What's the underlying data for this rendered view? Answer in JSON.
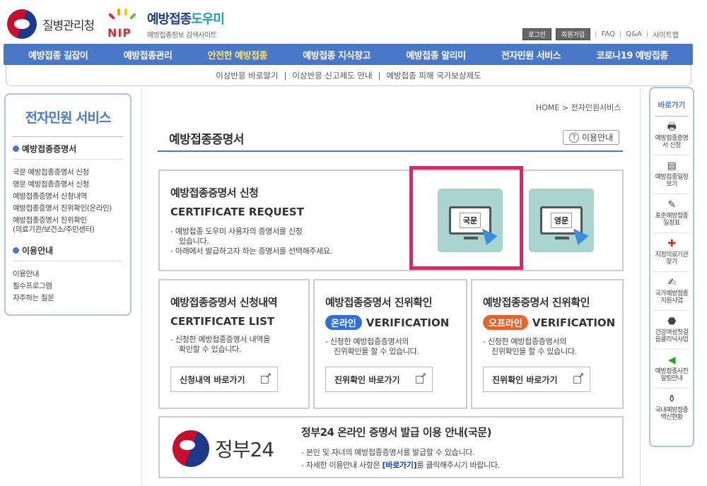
{
  "header": {
    "kdca_name": "질병관리청",
    "nip_letters": "NIP",
    "site_title_part1": "예방접종",
    "site_title_part2": "도우미",
    "site_subtitle": "예방접종정보 검색사이트",
    "util": {
      "login": "로그인",
      "join": "회원가입",
      "faq": "FAQ",
      "qna": "Q&A",
      "sitemap": "사이트맵",
      "sep": "|"
    }
  },
  "gnb": [
    {
      "label": "예방접종 길잡이",
      "active": false
    },
    {
      "label": "예방접종관리",
      "active": false
    },
    {
      "label": "안전한 예방접종",
      "active": true
    },
    {
      "label": "예방접종 지식창고",
      "active": false
    },
    {
      "label": "예방접종 알리미",
      "active": false
    },
    {
      "label": "전자민원 서비스",
      "active": false
    },
    {
      "label": "코로나19 예방접종",
      "active": false
    }
  ],
  "sub_gnb": [
    "이상반응 바로알기",
    "|",
    "이상반응 신고제도 안내",
    "|",
    "예방접종 피해 국가보상제도"
  ],
  "lnb": {
    "title": "전자민원 서비스",
    "section1": "예방접종증명서",
    "section1_items": [
      "국문 예방접종증명서 신청",
      "영문 예방접종증명서 신청",
      "예방접종증명서 신청내역",
      "예방접종증명서 진위확인(온라인)",
      "예방접종증명서 진위확인",
      "(의료기관/보건소/주민센터)"
    ],
    "section2": "이용안내",
    "section2_items": [
      "이용안내",
      "필수프로그램",
      "자주하는 질문"
    ]
  },
  "main": {
    "breadcrumb": "HOME > 전자민원서비스",
    "page_title": "예방접종증명서",
    "guide_button": "이용안내",
    "guide_icon": "?",
    "request": {
      "title": "예방접종증명서 신청",
      "en": "CERTIFICATE REQUEST",
      "desc1": "- 예방접종 도우미 사용자의 증명서를 신청",
      "desc2": "있습니다.",
      "desc3": "- 아래에서 발급하고자 하는 증명서를 선택해주세요.",
      "korean_card": "국문",
      "english_card": "영문"
    },
    "list": {
      "title": "예방접종증명서 신청내역",
      "en": "CERTIFICATE LIST",
      "desc1": "- 신청한 예방접종증명서 내역을",
      "desc2": "확인할 수 있습니다.",
      "button": "신청내역 바로가기"
    },
    "verify_online": {
      "title": "예방접종증명서 진위확인",
      "badge": "온라인",
      "badge_color": "#2f6fd6",
      "en": "VERIFICATION",
      "desc1": "- 신청한 예방접종증명서의",
      "desc2": "진위확인을 할 수 있습니다.",
      "button": "진위확인 바로가기"
    },
    "verify_offline": {
      "title": "예방접종증명서 진위확인",
      "badge": "오프라인",
      "badge_color": "#e8632b",
      "en": "VERIFICATION",
      "desc1": "- 신청한 예방접종증명서의",
      "desc2": "진위확인을 할 수 있습니다.",
      "button": "진위확인 바로가기"
    },
    "gov24": {
      "logo_text": "정부24",
      "title": "정부24 온라인 증명서 발급 이용 안내(국문)",
      "desc1": "- 본인 및 자녀의 예방접종증명서를 발급할 수 있습니다.",
      "desc2_prefix": "- 자세한 이용안내 사항은 ",
      "desc2_link": "[바로가기]",
      "desc2_suffix": "를 클릭해주시기 바랍니다."
    }
  },
  "quick": {
    "title": "바로가기",
    "items": [
      {
        "icon": "printer-icon",
        "label": "예방접종증명서 신청"
      },
      {
        "icon": "calendar-icon",
        "label": "예방접종일정보기"
      },
      {
        "icon": "syringe-icon",
        "label": "표준예방접종일정표"
      },
      {
        "icon": "hospital-icon",
        "label": "지정의료기관찾기"
      },
      {
        "icon": "document-icon",
        "label": "국가예방접종지원사업"
      },
      {
        "icon": "health-icon",
        "label": "건강여성첫걸음클리닉사업"
      },
      {
        "icon": "speaker-icon",
        "label": "예방접종사전알림안내"
      },
      {
        "icon": "vaccine-icon",
        "label": "국내예방접종백신현황"
      }
    ]
  },
  "colors": {
    "brand_blue": "#4a78c8",
    "highlight": "#ee1c6a",
    "card_teal": "#a9d3cf"
  }
}
